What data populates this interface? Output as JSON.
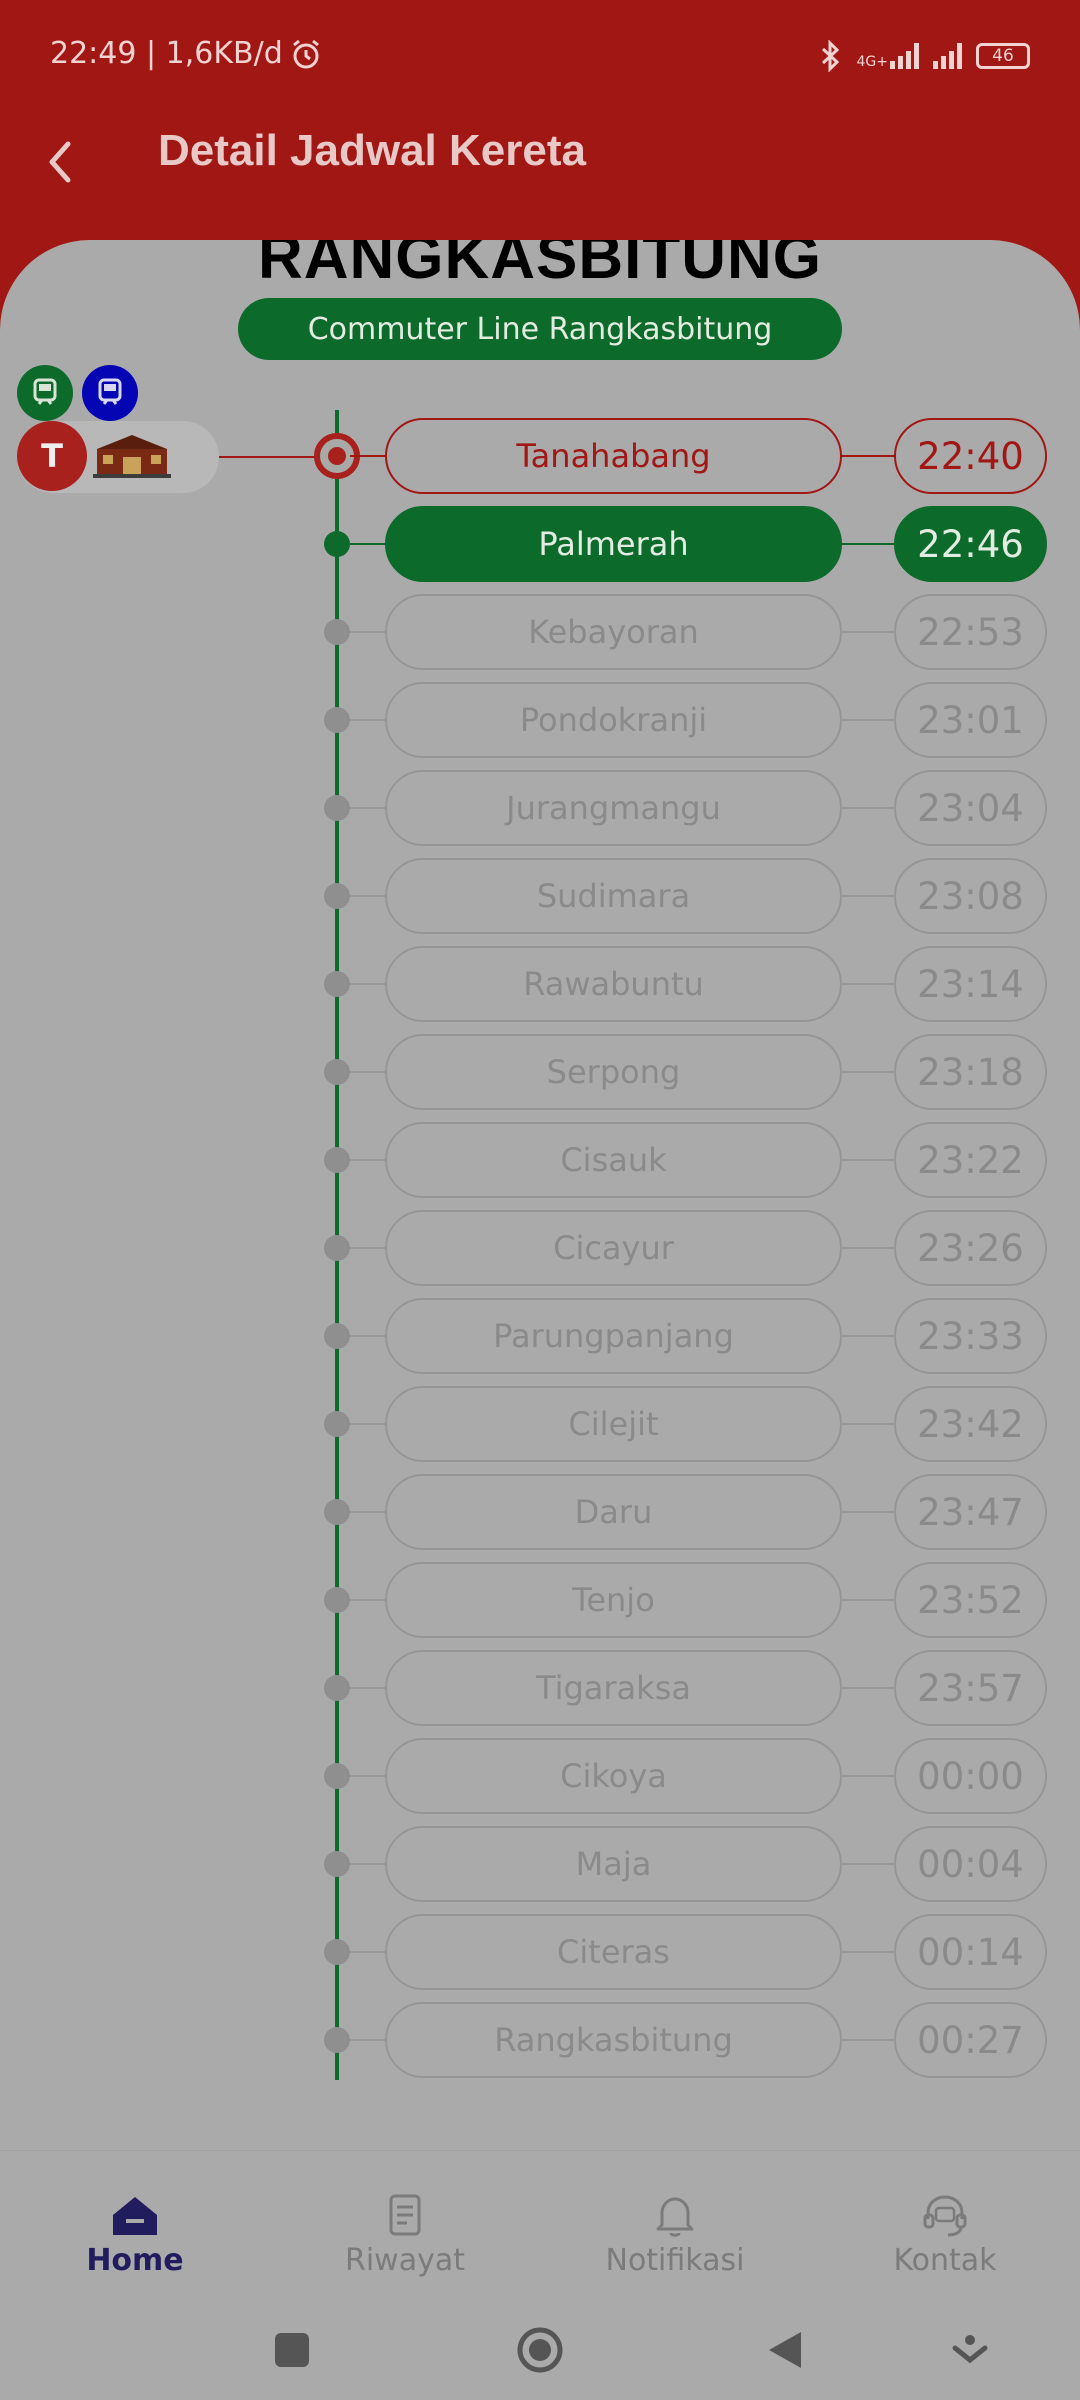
{
  "status_bar": {
    "time_speed": "22:49 | 1,6KB/d",
    "network_label": "4G+",
    "battery": "46"
  },
  "header": {
    "title": "Detail Jadwal Kereta"
  },
  "route": {
    "title": "RANGKASBITUNG",
    "line_name": "Commuter Line Rangkasbitung",
    "station_badge": "T"
  },
  "stops": [
    {
      "name": "Tanahabang",
      "time": "22:40",
      "state": "departed"
    },
    {
      "name": "Palmerah",
      "time": "22:46",
      "state": "current"
    },
    {
      "name": "Kebayoran",
      "time": "22:53",
      "state": "upcoming"
    },
    {
      "name": "Pondokranji",
      "time": "23:01",
      "state": "upcoming"
    },
    {
      "name": "Jurangmangu",
      "time": "23:04",
      "state": "upcoming"
    },
    {
      "name": "Sudimara",
      "time": "23:08",
      "state": "upcoming"
    },
    {
      "name": "Rawabuntu",
      "time": "23:14",
      "state": "upcoming"
    },
    {
      "name": "Serpong",
      "time": "23:18",
      "state": "upcoming"
    },
    {
      "name": "Cisauk",
      "time": "23:22",
      "state": "upcoming"
    },
    {
      "name": "Cicayur",
      "time": "23:26",
      "state": "upcoming"
    },
    {
      "name": "Parungpanjang",
      "time": "23:33",
      "state": "upcoming"
    },
    {
      "name": "Cilejit",
      "time": "23:42",
      "state": "upcoming"
    },
    {
      "name": "Daru",
      "time": "23:47",
      "state": "upcoming"
    },
    {
      "name": "Tenjo",
      "time": "23:52",
      "state": "upcoming"
    },
    {
      "name": "Tigaraksa",
      "time": "23:57",
      "state": "upcoming"
    },
    {
      "name": "Cikoya",
      "time": "00:00",
      "state": "upcoming"
    },
    {
      "name": "Maja",
      "time": "00:04",
      "state": "upcoming"
    },
    {
      "name": "Citeras",
      "time": "00:14",
      "state": "upcoming"
    },
    {
      "name": "Rangkasbitung",
      "time": "00:27",
      "state": "upcoming"
    }
  ],
  "bottom_nav": [
    {
      "label": "Home",
      "icon": "home-icon",
      "active": true
    },
    {
      "label": "Riwayat",
      "icon": "history-icon",
      "active": false
    },
    {
      "label": "Notifikasi",
      "icon": "bell-icon",
      "active": false
    },
    {
      "label": "Kontak",
      "icon": "headset-icon",
      "active": false
    }
  ],
  "colors": {
    "primary_red": "#a01714",
    "line_green": "#0c6a2b",
    "overlay_gray": "#aaaaaa",
    "nav_active": "#211c5e"
  }
}
